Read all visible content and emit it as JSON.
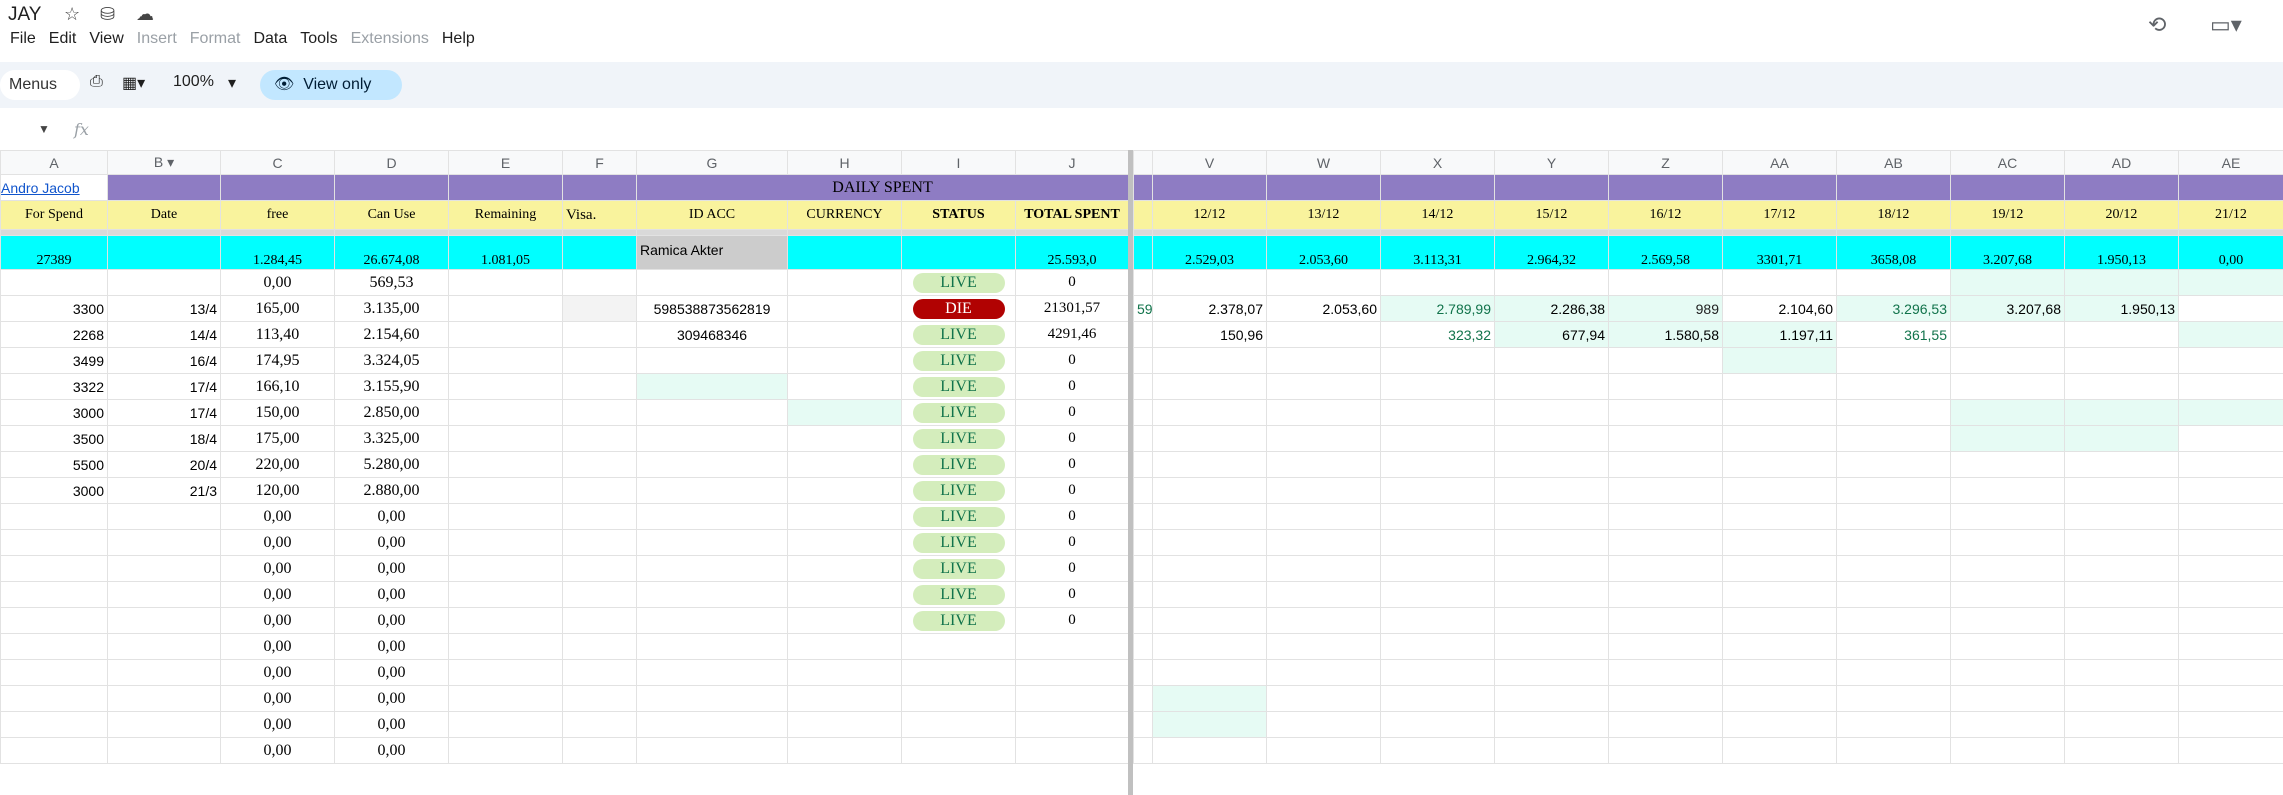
{
  "app": {
    "title": "JAY"
  },
  "menus": [
    {
      "label": "File",
      "enabled": true
    },
    {
      "label": "Edit",
      "enabled": true
    },
    {
      "label": "View",
      "enabled": true
    },
    {
      "label": "Insert",
      "enabled": false
    },
    {
      "label": "Format",
      "enabled": false
    },
    {
      "label": "Data",
      "enabled": true
    },
    {
      "label": "Tools",
      "enabled": true
    },
    {
      "label": "Extensions",
      "enabled": false
    },
    {
      "label": "Help",
      "enabled": true
    }
  ],
  "toolbar": {
    "menus_label": "Menus",
    "zoom": "100%",
    "view_only_label": "View only"
  },
  "formula": {
    "fx": "fx"
  },
  "columns_left": [
    "A",
    "B",
    "C",
    "D",
    "E",
    "F",
    "G",
    "H",
    "I",
    "J"
  ],
  "columns_right": [
    "V",
    "W",
    "X",
    "Y",
    "Z",
    "AA",
    "AB",
    "AC",
    "AD",
    "AE"
  ],
  "row_link": "Andro Jacob",
  "daily_spent": "DAILY SPENT",
  "headers_left": [
    "For Spend",
    "Date",
    "free",
    "Can Use",
    "Remaining",
    "Visa.",
    "ID ACC",
    "CURRENCY",
    "STATUS",
    "TOTAL SPENT"
  ],
  "headers_right": [
    "12/12",
    "13/12",
    "14/12",
    "15/12",
    "16/12",
    "17/12",
    "18/12",
    "19/12",
    "20/12",
    "21/12"
  ],
  "totals_left": [
    "27389",
    "",
    "1.284,45",
    "26.674,08",
    "1.081,05",
    "",
    "Ramica Akter",
    "",
    "",
    "25.593,0"
  ],
  "totals_right": [
    "2.529,03",
    "2.053,60",
    "3.113,31",
    "2.964,32",
    "2.569,58",
    "3301,71",
    "3658,08",
    "3.207,68",
    "1.950,13",
    "0,00"
  ],
  "rows": [
    {
      "a": "",
      "b": "",
      "c": "0,00",
      "d": "569,53",
      "g": "",
      "status": "LIVE",
      "j": "0",
      "right": [
        "",
        "",
        "",
        "",
        "",
        "",
        "",
        "",
        "",
        ""
      ]
    },
    {
      "a": "3300",
      "b": "13/4",
      "c": "165,00",
      "d": "3.135,00",
      "g": "598538873562819",
      "status": "DIE",
      "j": "21301,57",
      "u": "59",
      "right": [
        "2.378,07",
        "2.053,60",
        "2.789,99",
        "2.286,38",
        "989",
        "2.104,60",
        "3.296,53",
        "3.207,68",
        "1.950,13",
        ""
      ]
    },
    {
      "a": "2268",
      "b": "14/4",
      "c": "113,40",
      "d": "2.154,60",
      "g": "309468346",
      "status": "LIVE",
      "j": "4291,46",
      "right": [
        "150,96",
        "",
        "323,32",
        "677,94",
        "1.580,58",
        "1.197,11",
        "361,55",
        "",
        "",
        ""
      ]
    },
    {
      "a": "3499",
      "b": "16/4",
      "c": "174,95",
      "d": "3.324,05",
      "g": "",
      "status": "LIVE",
      "j": "0",
      "right": [
        "",
        "",
        "",
        "",
        "",
        "",
        "",
        "",
        "",
        ""
      ]
    },
    {
      "a": "3322",
      "b": "17/4",
      "c": "166,10",
      "d": "3.155,90",
      "g": "",
      "status": "LIVE",
      "j": "0",
      "right": [
        "",
        "",
        "",
        "",
        "",
        "",
        "",
        "",
        "",
        ""
      ]
    },
    {
      "a": "3000",
      "b": "17/4",
      "c": "150,00",
      "d": "2.850,00",
      "g": "",
      "status": "LIVE",
      "j": "0",
      "right": [
        "",
        "",
        "",
        "",
        "",
        "",
        "",
        "",
        "",
        ""
      ]
    },
    {
      "a": "3500",
      "b": "18/4",
      "c": "175,00",
      "d": "3.325,00",
      "g": "",
      "status": "LIVE",
      "j": "0",
      "right": [
        "",
        "",
        "",
        "",
        "",
        "",
        "",
        "",
        "",
        ""
      ]
    },
    {
      "a": "5500",
      "b": "20/4",
      "c": "220,00",
      "d": "5.280,00",
      "g": "",
      "status": "LIVE",
      "j": "0",
      "right": [
        "",
        "",
        "",
        "",
        "",
        "",
        "",
        "",
        "",
        ""
      ]
    },
    {
      "a": "3000",
      "b": "21/3",
      "c": "120,00",
      "d": "2.880,00",
      "g": "",
      "status": "LIVE",
      "j": "0",
      "right": [
        "",
        "",
        "",
        "",
        "",
        "",
        "",
        "",
        "",
        ""
      ]
    },
    {
      "a": "",
      "b": "",
      "c": "0,00",
      "d": "0,00",
      "g": "",
      "status": "LIVE",
      "j": "0",
      "right": [
        "",
        "",
        "",
        "",
        "",
        "",
        "",
        "",
        "",
        ""
      ]
    },
    {
      "a": "",
      "b": "",
      "c": "0,00",
      "d": "0,00",
      "g": "",
      "status": "LIVE",
      "j": "0",
      "right": [
        "",
        "",
        "",
        "",
        "",
        "",
        "",
        "",
        "",
        ""
      ]
    },
    {
      "a": "",
      "b": "",
      "c": "0,00",
      "d": "0,00",
      "g": "",
      "status": "LIVE",
      "j": "0",
      "right": [
        "",
        "",
        "",
        "",
        "",
        "",
        "",
        "",
        "",
        ""
      ]
    },
    {
      "a": "",
      "b": "",
      "c": "0,00",
      "d": "0,00",
      "g": "",
      "status": "LIVE",
      "j": "0",
      "right": [
        "",
        "",
        "",
        "",
        "",
        "",
        "",
        "",
        "",
        ""
      ]
    },
    {
      "a": "",
      "b": "",
      "c": "0,00",
      "d": "0,00",
      "g": "",
      "status": "LIVE",
      "j": "0",
      "right": [
        "",
        "",
        "",
        "",
        "",
        "",
        "",
        "",
        "",
        ""
      ]
    },
    {
      "a": "",
      "b": "",
      "c": "0,00",
      "d": "0,00",
      "g": "",
      "status": "",
      "j": "",
      "right": [
        "",
        "",
        "",
        "",
        "",
        "",
        "",
        "",
        "",
        ""
      ]
    },
    {
      "a": "",
      "b": "",
      "c": "0,00",
      "d": "0,00",
      "g": "",
      "status": "",
      "j": "",
      "right": [
        "",
        "",
        "",
        "",
        "",
        "",
        "",
        "",
        "",
        ""
      ]
    },
    {
      "a": "",
      "b": "",
      "c": "0,00",
      "d": "0,00",
      "g": "",
      "status": "",
      "j": "",
      "right": [
        "",
        "",
        "",
        "",
        "",
        "",
        "",
        "",
        "",
        ""
      ]
    },
    {
      "a": "",
      "b": "",
      "c": "0,00",
      "d": "0,00",
      "g": "",
      "status": "",
      "j": "",
      "right": [
        "",
        "",
        "",
        "",
        "",
        "",
        "",
        "",
        "",
        ""
      ]
    },
    {
      "a": "",
      "b": "",
      "c": "0,00",
      "d": "0,00",
      "g": "",
      "status": "",
      "j": "",
      "right": [
        "",
        "",
        "",
        "",
        "",
        "",
        "",
        "",
        "",
        ""
      ]
    }
  ],
  "colors": {
    "purple": "#8e7cc3",
    "yellow": "#f9f39d",
    "cyan": "#00ffff",
    "live_bg": "#d4edbc",
    "die_bg": "#b10202",
    "green_text": "#11734b",
    "mint": "#e6fbf4"
  }
}
